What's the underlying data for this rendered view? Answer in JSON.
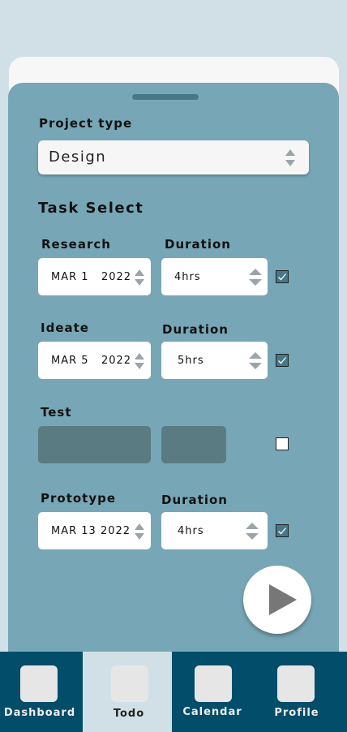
{
  "project": {
    "label": "Project type",
    "selected": "Design"
  },
  "task_section": {
    "title": "Task Select"
  },
  "tasks": [
    {
      "name": "Research",
      "duration_label": "Duration",
      "date": "MAR 1   2022",
      "duration": "4hrs",
      "checked": true
    },
    {
      "name": "Ideate",
      "duration_label": "Duration",
      "date": "MAR 5   2022",
      "duration": "5hrs",
      "checked": true
    },
    {
      "name": "Test",
      "checked": false
    },
    {
      "name": "Prototype",
      "duration_label": "Duration",
      "date": "MAR 13 2022",
      "duration": "4hrs",
      "checked": true
    }
  ],
  "nav": [
    {
      "label": "Dashboard",
      "active": false
    },
    {
      "label": "Todo",
      "active": true
    },
    {
      "label": "Calendar",
      "active": false
    },
    {
      "label": "Profile",
      "active": false
    }
  ],
  "colors": {
    "background": "#d0e0e6",
    "sheet": "#77a7b6",
    "nav": "#024d6a",
    "checkbox": "#467887"
  }
}
